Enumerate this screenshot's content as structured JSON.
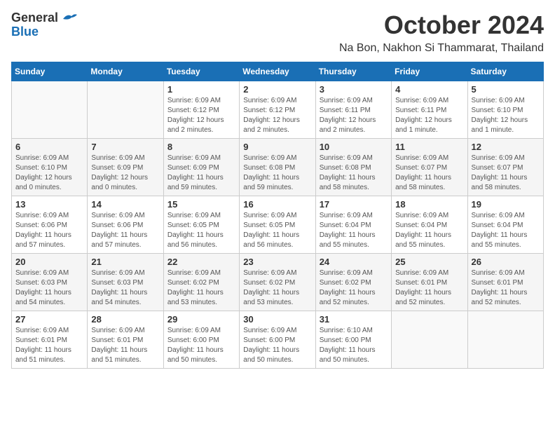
{
  "header": {
    "logo_general": "General",
    "logo_blue": "Blue",
    "month_title": "October 2024",
    "location": "Na Bon, Nakhon Si Thammarat, Thailand"
  },
  "weekdays": [
    "Sunday",
    "Monday",
    "Tuesday",
    "Wednesday",
    "Thursday",
    "Friday",
    "Saturday"
  ],
  "weeks": [
    [
      {
        "day": "",
        "info": ""
      },
      {
        "day": "",
        "info": ""
      },
      {
        "day": "1",
        "info": "Sunrise: 6:09 AM\nSunset: 6:12 PM\nDaylight: 12 hours\nand 2 minutes."
      },
      {
        "day": "2",
        "info": "Sunrise: 6:09 AM\nSunset: 6:12 PM\nDaylight: 12 hours\nand 2 minutes."
      },
      {
        "day": "3",
        "info": "Sunrise: 6:09 AM\nSunset: 6:11 PM\nDaylight: 12 hours\nand 2 minutes."
      },
      {
        "day": "4",
        "info": "Sunrise: 6:09 AM\nSunset: 6:11 PM\nDaylight: 12 hours\nand 1 minute."
      },
      {
        "day": "5",
        "info": "Sunrise: 6:09 AM\nSunset: 6:10 PM\nDaylight: 12 hours\nand 1 minute."
      }
    ],
    [
      {
        "day": "6",
        "info": "Sunrise: 6:09 AM\nSunset: 6:10 PM\nDaylight: 12 hours\nand 0 minutes."
      },
      {
        "day": "7",
        "info": "Sunrise: 6:09 AM\nSunset: 6:09 PM\nDaylight: 12 hours\nand 0 minutes."
      },
      {
        "day": "8",
        "info": "Sunrise: 6:09 AM\nSunset: 6:09 PM\nDaylight: 11 hours\nand 59 minutes."
      },
      {
        "day": "9",
        "info": "Sunrise: 6:09 AM\nSunset: 6:08 PM\nDaylight: 11 hours\nand 59 minutes."
      },
      {
        "day": "10",
        "info": "Sunrise: 6:09 AM\nSunset: 6:08 PM\nDaylight: 11 hours\nand 58 minutes."
      },
      {
        "day": "11",
        "info": "Sunrise: 6:09 AM\nSunset: 6:07 PM\nDaylight: 11 hours\nand 58 minutes."
      },
      {
        "day": "12",
        "info": "Sunrise: 6:09 AM\nSunset: 6:07 PM\nDaylight: 11 hours\nand 58 minutes."
      }
    ],
    [
      {
        "day": "13",
        "info": "Sunrise: 6:09 AM\nSunset: 6:06 PM\nDaylight: 11 hours\nand 57 minutes."
      },
      {
        "day": "14",
        "info": "Sunrise: 6:09 AM\nSunset: 6:06 PM\nDaylight: 11 hours\nand 57 minutes."
      },
      {
        "day": "15",
        "info": "Sunrise: 6:09 AM\nSunset: 6:05 PM\nDaylight: 11 hours\nand 56 minutes."
      },
      {
        "day": "16",
        "info": "Sunrise: 6:09 AM\nSunset: 6:05 PM\nDaylight: 11 hours\nand 56 minutes."
      },
      {
        "day": "17",
        "info": "Sunrise: 6:09 AM\nSunset: 6:04 PM\nDaylight: 11 hours\nand 55 minutes."
      },
      {
        "day": "18",
        "info": "Sunrise: 6:09 AM\nSunset: 6:04 PM\nDaylight: 11 hours\nand 55 minutes."
      },
      {
        "day": "19",
        "info": "Sunrise: 6:09 AM\nSunset: 6:04 PM\nDaylight: 11 hours\nand 55 minutes."
      }
    ],
    [
      {
        "day": "20",
        "info": "Sunrise: 6:09 AM\nSunset: 6:03 PM\nDaylight: 11 hours\nand 54 minutes."
      },
      {
        "day": "21",
        "info": "Sunrise: 6:09 AM\nSunset: 6:03 PM\nDaylight: 11 hours\nand 54 minutes."
      },
      {
        "day": "22",
        "info": "Sunrise: 6:09 AM\nSunset: 6:02 PM\nDaylight: 11 hours\nand 53 minutes."
      },
      {
        "day": "23",
        "info": "Sunrise: 6:09 AM\nSunset: 6:02 PM\nDaylight: 11 hours\nand 53 minutes."
      },
      {
        "day": "24",
        "info": "Sunrise: 6:09 AM\nSunset: 6:02 PM\nDaylight: 11 hours\nand 52 minutes."
      },
      {
        "day": "25",
        "info": "Sunrise: 6:09 AM\nSunset: 6:01 PM\nDaylight: 11 hours\nand 52 minutes."
      },
      {
        "day": "26",
        "info": "Sunrise: 6:09 AM\nSunset: 6:01 PM\nDaylight: 11 hours\nand 52 minutes."
      }
    ],
    [
      {
        "day": "27",
        "info": "Sunrise: 6:09 AM\nSunset: 6:01 PM\nDaylight: 11 hours\nand 51 minutes."
      },
      {
        "day": "28",
        "info": "Sunrise: 6:09 AM\nSunset: 6:01 PM\nDaylight: 11 hours\nand 51 minutes."
      },
      {
        "day": "29",
        "info": "Sunrise: 6:09 AM\nSunset: 6:00 PM\nDaylight: 11 hours\nand 50 minutes."
      },
      {
        "day": "30",
        "info": "Sunrise: 6:09 AM\nSunset: 6:00 PM\nDaylight: 11 hours\nand 50 minutes."
      },
      {
        "day": "31",
        "info": "Sunrise: 6:10 AM\nSunset: 6:00 PM\nDaylight: 11 hours\nand 50 minutes."
      },
      {
        "day": "",
        "info": ""
      },
      {
        "day": "",
        "info": ""
      }
    ]
  ]
}
